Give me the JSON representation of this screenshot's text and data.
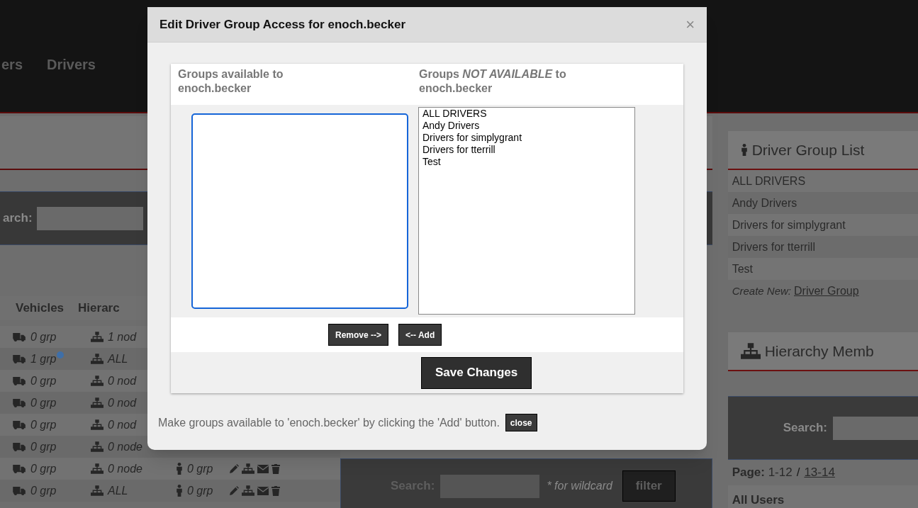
{
  "nav": {
    "items": [
      "ers",
      "Drivers"
    ]
  },
  "users_panel": {
    "search_label": "arch:"
  },
  "users_table": {
    "columns": [
      "Vehicles",
      "Hierarc"
    ],
    "rows": [
      {
        "vehicles": "0 grp",
        "info": false,
        "hierarchy": "1 nod"
      },
      {
        "vehicles": "1 grp",
        "info": true,
        "hierarchy": "ALL"
      },
      {
        "vehicles": "0 grp",
        "info": false,
        "hierarchy": "0 nod"
      },
      {
        "vehicles": "0 grp",
        "info": false,
        "hierarchy": "0 nod"
      },
      {
        "vehicles": "0 grp",
        "info": false,
        "hierarchy": "0 nod"
      },
      {
        "vehicles": "0 grp",
        "info": false,
        "hierarchy": "0 node"
      },
      {
        "vehicles": "0 grp",
        "info": false,
        "hierarchy": "0 node",
        "drivers": "0 grp"
      },
      {
        "vehicles": "0 grp",
        "info": false,
        "hierarchy": "ALL",
        "drivers": "0 grp"
      }
    ]
  },
  "user_search": {
    "label": "Search:",
    "hint": "* for wildcard",
    "button": "filter"
  },
  "driver_group_list": {
    "title": "Driver Group List",
    "items": [
      "ALL DRIVERS",
      "Andy Drivers",
      "Drivers for simplygrant",
      "Drivers for tterrill",
      "Test"
    ],
    "create_label": "Create New:",
    "create_link": "Driver Group"
  },
  "hierarchy_panel": {
    "title": "Hierarchy Memb",
    "search_label": "Search:",
    "page_label": "Page:",
    "page_current": "1-12",
    "page_separator": "/",
    "page_link": "13-14",
    "section": "All Users"
  },
  "dialog": {
    "title": "Edit Driver Group Access for enoch.becker",
    "close_glyph": "×",
    "available_heading": "Groups available to enoch.becker",
    "not_available_heading": "Groups *NOT AVAILABLE* to enoch.becker",
    "available_focused": true,
    "not_available_groups": [
      "ALL DRIVERS",
      "Andy Drivers",
      "Drivers for simplygrant",
      "Drivers for tterrill",
      "Test"
    ],
    "remove_button": "Remove -->",
    "add_button": "<-- Add",
    "save_button": "Save Changes",
    "hint": "Make groups available to 'enoch.becker' by clicking the 'Add' button.",
    "close_button": "close"
  }
}
